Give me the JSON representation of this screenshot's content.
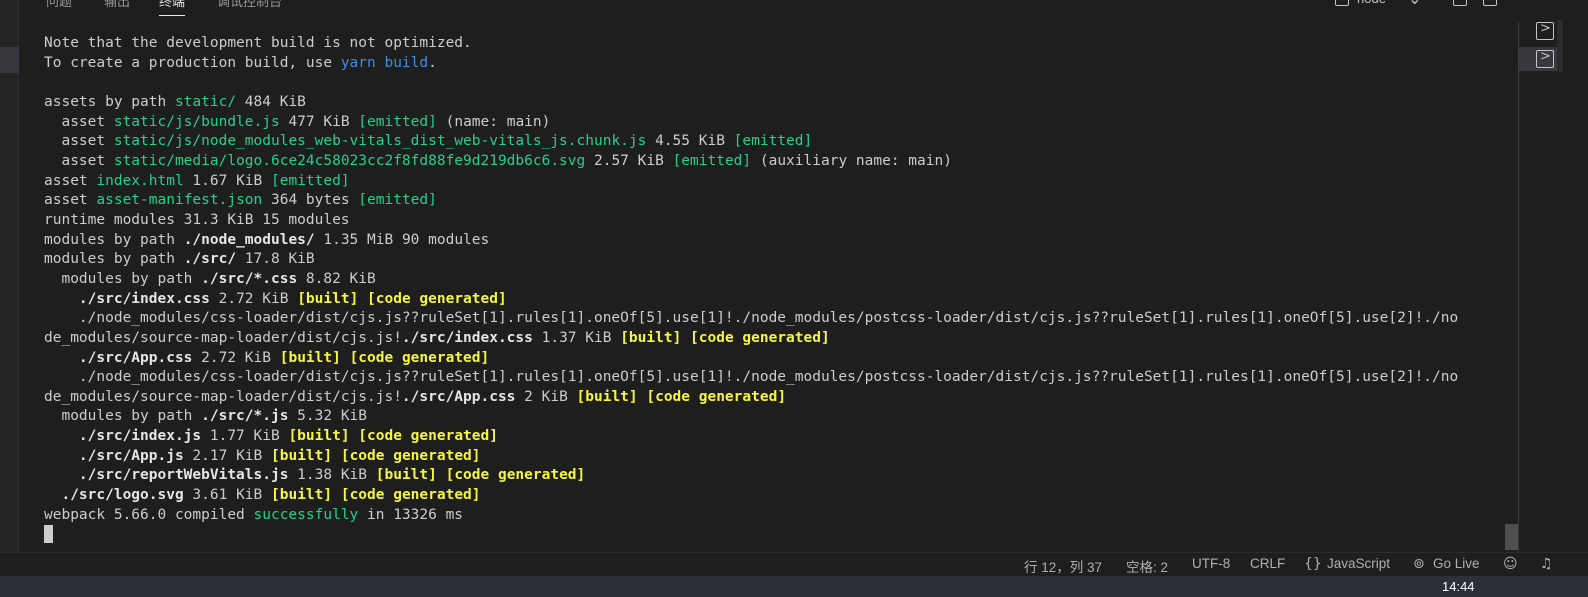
{
  "panel": {
    "tabs": [
      "问题",
      "输出",
      "终端",
      "调试控制台"
    ],
    "active_tab_index": 2,
    "terminal_type": "node"
  },
  "terminal": {
    "lines": [
      [
        {
          "t": "Note that the development build is not optimized."
        }
      ],
      [
        {
          "t": "To create a production build, use "
        },
        {
          "t": "yarn build",
          "c": "blue"
        },
        {
          "t": "."
        }
      ],
      [
        {
          "t": ""
        }
      ],
      [
        {
          "t": "assets by path "
        },
        {
          "t": "static/",
          "c": "green"
        },
        {
          "t": " 484 KiB"
        }
      ],
      [
        {
          "t": "  asset "
        },
        {
          "t": "static/js/bundle.js",
          "c": "green"
        },
        {
          "t": " 477 KiB "
        },
        {
          "t": "[emitted]",
          "c": "green"
        },
        {
          "t": " (name: main)"
        }
      ],
      [
        {
          "t": "  asset "
        },
        {
          "t": "static/js/node_modules_web-vitals_dist_web-vitals_js.chunk.js",
          "c": "green"
        },
        {
          "t": " 4.55 KiB "
        },
        {
          "t": "[emitted]",
          "c": "green"
        }
      ],
      [
        {
          "t": "  asset "
        },
        {
          "t": "static/media/logo.6ce24c58023cc2f8fd88fe9d219db6c6.svg",
          "c": "green"
        },
        {
          "t": " 2.57 KiB "
        },
        {
          "t": "[emitted]",
          "c": "green"
        },
        {
          "t": " (auxiliary name: main)"
        }
      ],
      [
        {
          "t": "asset "
        },
        {
          "t": "index.html",
          "c": "green"
        },
        {
          "t": " 1.67 KiB "
        },
        {
          "t": "[emitted]",
          "c": "green"
        }
      ],
      [
        {
          "t": "asset "
        },
        {
          "t": "asset-manifest.json",
          "c": "green"
        },
        {
          "t": " 364 bytes "
        },
        {
          "t": "[emitted]",
          "c": "green"
        }
      ],
      [
        {
          "t": "runtime modules 31.3 KiB 15 modules"
        }
      ],
      [
        {
          "t": "modules by path "
        },
        {
          "t": "./node_modules/",
          "c": "bold"
        },
        {
          "t": " 1.35 MiB 90 modules"
        }
      ],
      [
        {
          "t": "modules by path "
        },
        {
          "t": "./src/",
          "c": "bold"
        },
        {
          "t": " 17.8 KiB"
        }
      ],
      [
        {
          "t": "  modules by path "
        },
        {
          "t": "./src/*.css",
          "c": "bold"
        },
        {
          "t": " 8.82 KiB"
        }
      ],
      [
        {
          "t": "    "
        },
        {
          "t": "./src/index.css",
          "c": "bold"
        },
        {
          "t": " 2.72 KiB "
        },
        {
          "t": "[built] [code generated]",
          "c": "yellow"
        }
      ],
      [
        {
          "t": "    ./node_modules/css-loader/dist/cjs.js??ruleSet[1].rules[1].oneOf[5].use[1]!./node_modules/postcss-loader/dist/cjs.js??ruleSet[1].rules[1].oneOf[5].use[2]!./no"
        }
      ],
      [
        {
          "t": "de_modules/source-map-loader/dist/cjs.js!"
        },
        {
          "t": "./src/index.css",
          "c": "bold"
        },
        {
          "t": " 1.37 KiB "
        },
        {
          "t": "[built] [code generated]",
          "c": "yellow"
        }
      ],
      [
        {
          "t": "    "
        },
        {
          "t": "./src/App.css",
          "c": "bold"
        },
        {
          "t": " 2.72 KiB "
        },
        {
          "t": "[built] [code generated]",
          "c": "yellow"
        }
      ],
      [
        {
          "t": "    ./node_modules/css-loader/dist/cjs.js??ruleSet[1].rules[1].oneOf[5].use[1]!./node_modules/postcss-loader/dist/cjs.js??ruleSet[1].rules[1].oneOf[5].use[2]!./no"
        }
      ],
      [
        {
          "t": "de_modules/source-map-loader/dist/cjs.js!"
        },
        {
          "t": "./src/App.css",
          "c": "bold"
        },
        {
          "t": " 2 KiB "
        },
        {
          "t": "[built] [code generated]",
          "c": "yellow"
        }
      ],
      [
        {
          "t": "  modules by path "
        },
        {
          "t": "./src/*.js",
          "c": "bold"
        },
        {
          "t": " 5.32 KiB"
        }
      ],
      [
        {
          "t": "    "
        },
        {
          "t": "./src/index.js",
          "c": "bold"
        },
        {
          "t": " 1.77 KiB "
        },
        {
          "t": "[built] [code generated]",
          "c": "yellow"
        }
      ],
      [
        {
          "t": "    "
        },
        {
          "t": "./src/App.js",
          "c": "bold"
        },
        {
          "t": " 2.17 KiB "
        },
        {
          "t": "[built] [code generated]",
          "c": "yellow"
        }
      ],
      [
        {
          "t": "    "
        },
        {
          "t": "./src/reportWebVitals.js",
          "c": "bold"
        },
        {
          "t": " 1.38 KiB "
        },
        {
          "t": "[built] [code generated]",
          "c": "yellow"
        }
      ],
      [
        {
          "t": "  "
        },
        {
          "t": "./src/logo.svg",
          "c": "bold"
        },
        {
          "t": " 3.61 KiB "
        },
        {
          "t": "[built] [code generated]",
          "c": "yellow"
        }
      ],
      [
        {
          "t": "webpack 5.66.0 compiled "
        },
        {
          "t": "successfully",
          "c": "green"
        },
        {
          "t": " in 13326 ms"
        }
      ]
    ]
  },
  "statusbar": {
    "cursor_position": "行 12，列 37",
    "indent": "空格: 2",
    "encoding": "UTF-8",
    "eol": "CRLF",
    "language": "JavaScript",
    "golive": "Go Live"
  },
  "taskbar": {
    "clock": "14:44"
  },
  "colors": {
    "blue": "#3b8eea",
    "green": "#23d18b",
    "yellow": "#f5f543",
    "background": "#1e1e1e"
  },
  "icons": [
    "terminal-icon",
    "chevron-down-icon",
    "split-icon",
    "trash-icon",
    "braces-icon",
    "broadcast-icon",
    "feedback-icon",
    "bell-icon"
  ]
}
